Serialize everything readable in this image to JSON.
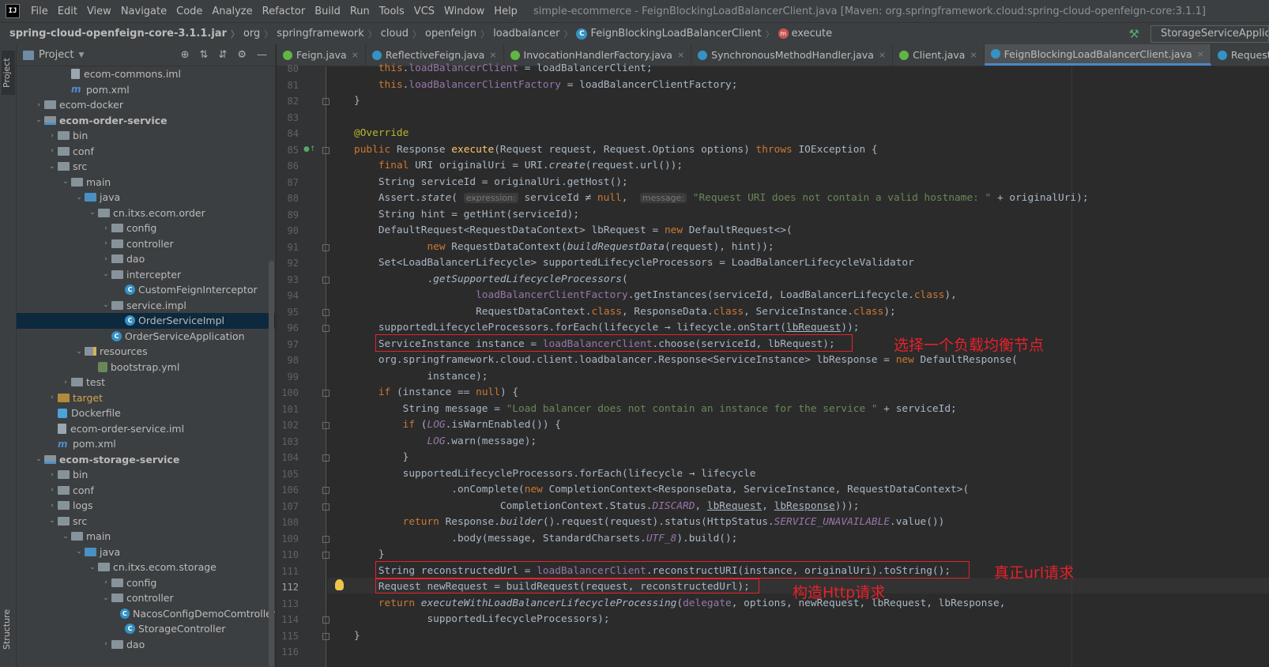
{
  "menubar": {
    "logo": "IJ",
    "items": [
      "File",
      "Edit",
      "View",
      "Navigate",
      "Code",
      "Analyze",
      "Refactor",
      "Build",
      "Run",
      "Tools",
      "VCS",
      "Window",
      "Help"
    ],
    "window_title": "simple-ecommerce - FeignBlockingLoadBalancerClient.java [Maven: org.springframework.cloud:spring-cloud-openfeign-core:3.1.1]"
  },
  "breadcrumb": {
    "items": [
      "spring-cloud-openfeign-core-3.1.1.jar",
      "org",
      "springframework",
      "cloud",
      "openfeign",
      "loadbalancer",
      "FeignBlockingLoadBalancerClient",
      "execute"
    ],
    "run_config": "StorageServiceApplication"
  },
  "side_strip": {
    "project": "Project",
    "structure": "Structure"
  },
  "project_panel": {
    "title": "Project",
    "tree": [
      {
        "label": "ecom-commons.iml",
        "type": "iml",
        "indent": 3,
        "arrow": ""
      },
      {
        "label": "pom.xml",
        "type": "maven",
        "indent": 3,
        "arrow": ""
      },
      {
        "label": "ecom-docker",
        "type": "folder",
        "indent": 1,
        "arrow": "›"
      },
      {
        "label": "ecom-order-service",
        "type": "module",
        "indent": 1,
        "arrow": "⌄",
        "bold": true
      },
      {
        "label": "bin",
        "type": "folder",
        "indent": 2,
        "arrow": "›"
      },
      {
        "label": "conf",
        "type": "folder",
        "indent": 2,
        "arrow": "›"
      },
      {
        "label": "src",
        "type": "folder",
        "indent": 2,
        "arrow": "⌄"
      },
      {
        "label": "main",
        "type": "folder",
        "indent": 3,
        "arrow": "⌄"
      },
      {
        "label": "java",
        "type": "src",
        "indent": 4,
        "arrow": "⌄"
      },
      {
        "label": "cn.itxs.ecom.order",
        "type": "folder",
        "indent": 5,
        "arrow": "⌄"
      },
      {
        "label": "config",
        "type": "folder",
        "indent": 6,
        "arrow": "›"
      },
      {
        "label": "controller",
        "type": "folder",
        "indent": 6,
        "arrow": "›"
      },
      {
        "label": "dao",
        "type": "folder",
        "indent": 6,
        "arrow": "›"
      },
      {
        "label": "intercepter",
        "type": "folder",
        "indent": 6,
        "arrow": "⌄"
      },
      {
        "label": "CustomFeignInterceptor",
        "type": "class",
        "indent": 7,
        "arrow": ""
      },
      {
        "label": "service.impl",
        "type": "folder",
        "indent": 6,
        "arrow": "⌄"
      },
      {
        "label": "OrderServiceImpl",
        "type": "class",
        "indent": 7,
        "arrow": "",
        "selected": true
      },
      {
        "label": "OrderServiceApplication",
        "type": "class",
        "indent": 6,
        "arrow": ""
      },
      {
        "label": "resources",
        "type": "res",
        "indent": 4,
        "arrow": "⌄"
      },
      {
        "label": "bootstrap.yml",
        "type": "yml",
        "indent": 5,
        "arrow": ""
      },
      {
        "label": "test",
        "type": "folder",
        "indent": 3,
        "arrow": "›"
      },
      {
        "label": "target",
        "type": "target",
        "indent": 2,
        "arrow": "›"
      },
      {
        "label": "Dockerfile",
        "type": "docker",
        "indent": 2,
        "arrow": ""
      },
      {
        "label": "ecom-order-service.iml",
        "type": "iml",
        "indent": 2,
        "arrow": ""
      },
      {
        "label": "pom.xml",
        "type": "maven",
        "indent": 2,
        "arrow": ""
      },
      {
        "label": "ecom-storage-service",
        "type": "module",
        "indent": 1,
        "arrow": "⌄",
        "bold": true
      },
      {
        "label": "bin",
        "type": "folder",
        "indent": 2,
        "arrow": "›"
      },
      {
        "label": "conf",
        "type": "folder",
        "indent": 2,
        "arrow": "›"
      },
      {
        "label": "logs",
        "type": "folder",
        "indent": 2,
        "arrow": "›"
      },
      {
        "label": "src",
        "type": "folder",
        "indent": 2,
        "arrow": "⌄"
      },
      {
        "label": "main",
        "type": "folder",
        "indent": 3,
        "arrow": "⌄"
      },
      {
        "label": "java",
        "type": "src",
        "indent": 4,
        "arrow": "⌄"
      },
      {
        "label": "cn.itxs.ecom.storage",
        "type": "folder",
        "indent": 5,
        "arrow": "⌄"
      },
      {
        "label": "config",
        "type": "folder",
        "indent": 6,
        "arrow": "›"
      },
      {
        "label": "controller",
        "type": "folder",
        "indent": 6,
        "arrow": "⌄"
      },
      {
        "label": "NacosConfigDemoComtroller",
        "type": "class",
        "indent": 7,
        "arrow": ""
      },
      {
        "label": "StorageController",
        "type": "class",
        "indent": 7,
        "arrow": ""
      },
      {
        "label": "dao",
        "type": "folder",
        "indent": 6,
        "arrow": "›"
      }
    ]
  },
  "tabs": [
    {
      "label": "Feign.java",
      "icon": "i"
    },
    {
      "label": "ReflectiveFeign.java",
      "icon": "c"
    },
    {
      "label": "InvocationHandlerFactory.java",
      "icon": "i"
    },
    {
      "label": "SynchronousMethodHandler.java",
      "icon": "c"
    },
    {
      "label": "Client.java",
      "icon": "i"
    },
    {
      "label": "FeignBlockingLoadBalancerClient.java",
      "icon": "c",
      "active": true
    },
    {
      "label": "Request.java",
      "icon": "c"
    }
  ],
  "editor": {
    "current_line": "112",
    "lines": [
      {
        "n": "80",
        "html": "    <span class=\"kw\">this</span>.<span class=\"fld\">loadBalancerClient</span> = loadBalancerClient;"
      },
      {
        "n": "81",
        "html": "    <span class=\"kw\">this</span>.<span class=\"fld\">loadBalancerClientFactory</span> = loadBalancerClientFactory;"
      },
      {
        "n": "82",
        "html": "}"
      },
      {
        "n": "83",
        "html": ""
      },
      {
        "n": "84",
        "html": "<span class=\"ann\">@Override</span>"
      },
      {
        "n": "85",
        "html": "<span class=\"kw\">public</span> Response <span style=\"color:#ffc66d\">execute</span>(Request request, Request.Options options) <span class=\"kw\">throws</span> IOException {"
      },
      {
        "n": "86",
        "html": "    <span class=\"kw\">final</span> URI originalUri = URI.<span class=\"it\">create</span>(request.url());"
      },
      {
        "n": "87",
        "html": "    String serviceId = originalUri.getHost();"
      },
      {
        "n": "88",
        "html": "    Assert.<span class=\"it\">state</span>( <span class=\"hint\">expression:</span> serviceId ≠ <span class=\"kw\">null</span>,  <span class=\"hint\">message:</span> <span class=\"str\">\"Request URI does not contain a valid hostname: \"</span> + originalUri);"
      },
      {
        "n": "89",
        "html": "    String hint = getHint(serviceId);"
      },
      {
        "n": "90",
        "html": "    DefaultRequest&lt;RequestDataContext&gt; lbRequest = <span class=\"kw\">new</span> DefaultRequest&lt;&gt;("
      },
      {
        "n": "91",
        "html": "            <span class=\"kw\">new</span> RequestDataContext(<span class=\"it\">buildRequestData</span>(request), hint));"
      },
      {
        "n": "92",
        "html": "    Set&lt;LoadBalancerLifecycle&gt; supportedLifecycleProcessors = LoadBalancerLifecycleValidator"
      },
      {
        "n": "93",
        "html": "            .<span class=\"it\">getSupportedLifecycleProcessors</span>("
      },
      {
        "n": "94",
        "html": "                    <span class=\"fld\">loadBalancerClientFactory</span>.getInstances(serviceId, LoadBalancerLifecycle.<span class=\"kw\">class</span>),"
      },
      {
        "n": "95",
        "html": "                    RequestDataContext.<span class=\"kw\">class</span>, ResponseData.<span class=\"kw\">class</span>, ServiceInstance.<span class=\"kw\">class</span>);"
      },
      {
        "n": "96",
        "html": "    supportedLifecycleProcessors.forEach(lifecycle → lifecycle.onStart(<span class=\"ul\">lbRequest</span>));"
      },
      {
        "n": "97",
        "html": "    ServiceInstance instance = <span class=\"fld\">loadBalancerClient</span>.choose(serviceId, lbRequest);"
      },
      {
        "n": "98",
        "html": "    org.springframework.cloud.client.loadbalancer.Response&lt;ServiceInstance&gt; lbResponse = <span class=\"kw\">new</span> DefaultResponse("
      },
      {
        "n": "99",
        "html": "            instance);"
      },
      {
        "n": "100",
        "html": "    <span class=\"kw\">if</span> (instance == <span class=\"kw\">null</span>) {"
      },
      {
        "n": "101",
        "html": "        String message = <span class=\"str\">\"Load balancer does not contain an instance for the service \"</span> + serviceId;"
      },
      {
        "n": "102",
        "html": "        <span class=\"kw\">if</span> (<span class=\"fld it\">LOG</span>.isWarnEnabled()) {"
      },
      {
        "n": "103",
        "html": "            <span class=\"fld it\">LOG</span>.warn(message);"
      },
      {
        "n": "104",
        "html": "        }"
      },
      {
        "n": "105",
        "html": "        supportedLifecycleProcessors.forEach(lifecycle → lifecycle"
      },
      {
        "n": "106",
        "html": "                .onComplete(<span class=\"kw\">new</span> CompletionContext&lt;ResponseData, ServiceInstance, RequestDataContext&gt;("
      },
      {
        "n": "107",
        "html": "                        CompletionContext.Status.<span class=\"fld it\">DISCARD</span>, <span class=\"ul\">lbRequest</span>, <span class=\"ul\">lbResponse</span>)));"
      },
      {
        "n": "108",
        "html": "        <span class=\"kw\">return</span> Response.<span class=\"it\">builder</span>().request(request).status(HttpStatus.<span class=\"fld it\">SERVICE_UNAVAILABLE</span>.value())"
      },
      {
        "n": "109",
        "html": "                .body(message, StandardCharsets.<span class=\"fld it\">UTF_8</span>).build();"
      },
      {
        "n": "110",
        "html": "    }"
      },
      {
        "n": "111",
        "html": "    String reconstructedUrl = <span class=\"fld\">loadBalancerClient</span>.reconstructURI(instance, originalUri).toString();"
      },
      {
        "n": "112",
        "html": "    Request newRequest = buildRequest(request, reconstructedUrl);"
      },
      {
        "n": "113",
        "html": "    <span class=\"kw\">return</span> <span class=\"it\">executeWithLoadBalancerLifecycleProcessing</span>(<span class=\"fld\">delegate</span>, options, newRequest, lbRequest, lbResponse,"
      },
      {
        "n": "114",
        "html": "            supportedLifecycleProcessors);"
      },
      {
        "n": "115",
        "html": "}"
      },
      {
        "n": "116",
        "html": ""
      }
    ]
  },
  "annotations": {
    "choose_note": "选择一个负载均衡节点",
    "url_note": "真正url请求",
    "http_note": "构造Http请求"
  },
  "colors": {
    "annotation_red": "#e8212b",
    "selection": "#0d293e",
    "keyword": "#cc7832"
  }
}
